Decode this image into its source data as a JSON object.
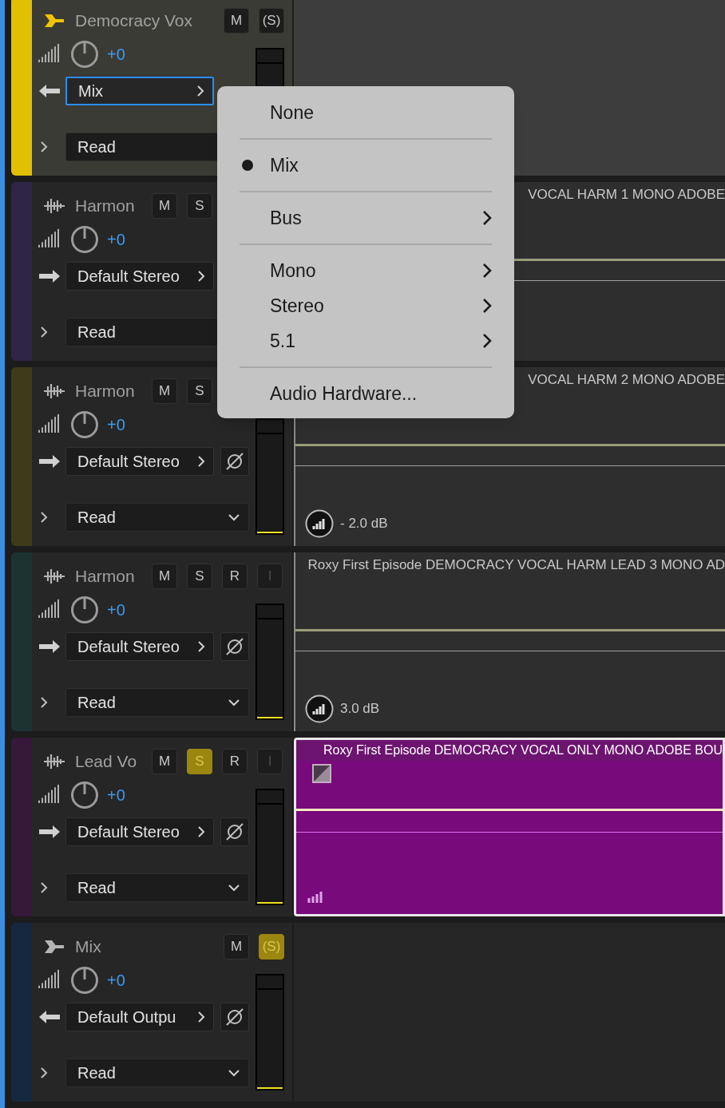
{
  "tracks": [
    {
      "kind": "bus",
      "name": "Democracy Vox",
      "selected": true,
      "color": "#e0c000",
      "fader_value": "+0",
      "output": "Mix",
      "output_focused": true,
      "phase_button": false,
      "automation": "Read",
      "meter": {
        "level": 0.015
      },
      "buttons": [
        {
          "label": "M",
          "selected": false,
          "disabled": false
        },
        {
          "label": "(S)",
          "selected": false,
          "disabled": false
        }
      ]
    },
    {
      "kind": "audio",
      "name": "Harmon",
      "selected": false,
      "color": "#2f2547",
      "fader_value": "+0",
      "output": "Default Stereo",
      "output_focused": false,
      "phase_button": false,
      "automation": "Read",
      "buttons": [
        {
          "label": "M",
          "selected": false,
          "disabled": false
        },
        {
          "label": "S",
          "selected": false,
          "disabled": false
        }
      ],
      "clip": {
        "title": "VOCAL HARM 1 MONO ADOBE",
        "selected": false
      }
    },
    {
      "kind": "audio",
      "name": "Harmon",
      "selected": false,
      "color": "#3f3a1a",
      "fader_value": "+0",
      "output": "Default Stereo",
      "output_focused": false,
      "phase_button": true,
      "automation": "Read",
      "caret": true,
      "meter": {
        "level": 0.015
      },
      "buttons": [
        {
          "label": "M",
          "selected": false,
          "disabled": false
        },
        {
          "label": "S",
          "selected": false,
          "disabled": false
        }
      ],
      "clip": {
        "title": "VOCAL HARM 2 MONO ADOBE",
        "selected": false,
        "volume": "- 2.0 dB"
      }
    },
    {
      "kind": "audio",
      "name": "Harmon",
      "selected": false,
      "color": "#1b3333",
      "fader_value": "+0",
      "output": "Default Stereo",
      "output_focused": false,
      "phase_button": true,
      "automation": "Read",
      "caret": true,
      "meter": {
        "level": 0.015
      },
      "buttons": [
        {
          "label": "M",
          "selected": false,
          "disabled": false
        },
        {
          "label": "S",
          "selected": false,
          "disabled": false
        },
        {
          "label": "R",
          "selected": false,
          "disabled": false
        },
        {
          "label": "I",
          "selected": false,
          "disabled": true
        }
      ],
      "clip": {
        "title": "Roxy First Episode DEMOCRACY VOCAL HARM LEAD 3 MONO AD",
        "selected": false,
        "volume": "3.0 dB"
      }
    },
    {
      "kind": "audio",
      "name": "Lead Vo",
      "selected": false,
      "color": "#35183a",
      "fader_value": "+0",
      "output": "Default Stereo",
      "output_focused": false,
      "phase_button": true,
      "automation": "Read",
      "caret": true,
      "meter": {
        "level": 0.015
      },
      "buttons": [
        {
          "label": "M",
          "selected": false,
          "disabled": false
        },
        {
          "label": "S",
          "selected": true,
          "disabled": false
        },
        {
          "label": "R",
          "selected": false,
          "disabled": false
        },
        {
          "label": "I",
          "selected": false,
          "disabled": true
        }
      ],
      "clip": {
        "title": "Roxy First Episode DEMOCRACY VOCAL ONLY MONO ADOBE BOU",
        "selected": true
      }
    },
    {
      "kind": "mix",
      "name": "Mix",
      "selected": false,
      "color": "#15283f",
      "fader_value": "+0",
      "output": "Default Outpu",
      "output_focused": false,
      "phase_button": true,
      "automation": "Read",
      "caret": true,
      "meter": {
        "level": 0.015
      },
      "buttons": [
        {
          "label": "M",
          "selected": false,
          "disabled": false
        },
        {
          "label": "(S)",
          "selected": true,
          "disabled": false
        }
      ]
    }
  ],
  "menu": {
    "groups": [
      {
        "items": [
          {
            "label": "None",
            "selected": false,
            "submenu": false
          }
        ]
      },
      {
        "items": [
          {
            "label": "Mix",
            "selected": true,
            "submenu": false
          }
        ]
      },
      {
        "items": [
          {
            "label": "Bus",
            "selected": false,
            "submenu": true
          }
        ]
      },
      {
        "items": [
          {
            "label": "Mono",
            "selected": false,
            "submenu": true
          },
          {
            "label": "Stereo",
            "selected": false,
            "submenu": true
          },
          {
            "label": "5.1",
            "selected": false,
            "submenu": true
          }
        ]
      },
      {
        "items": [
          {
            "label": "Audio Hardware...",
            "selected": false,
            "submenu": false
          }
        ]
      }
    ]
  }
}
